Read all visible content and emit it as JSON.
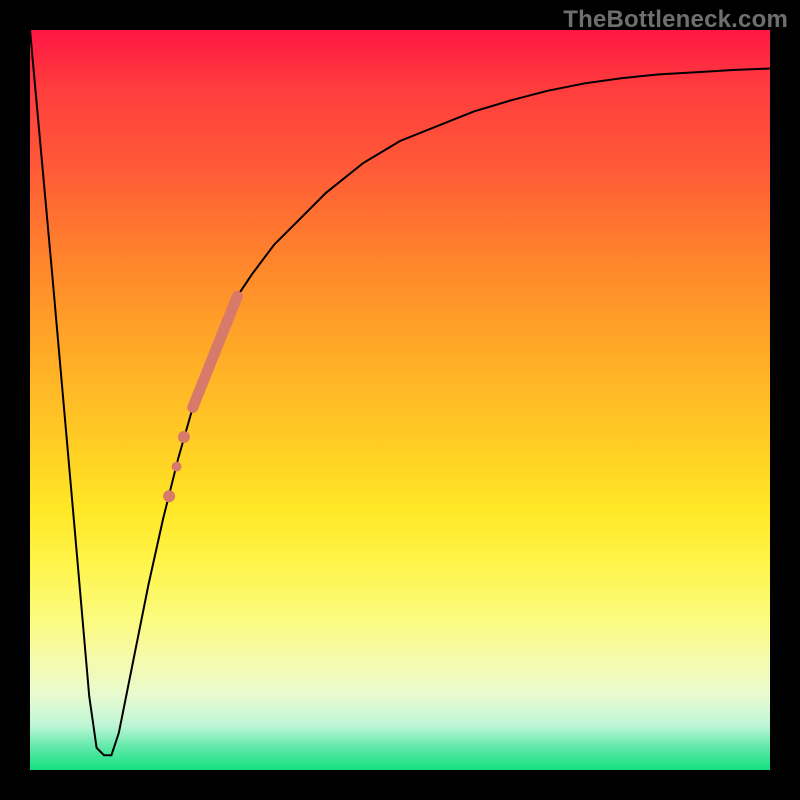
{
  "watermark": "TheBottleneck.com",
  "chart_data": {
    "type": "line",
    "title": "",
    "xlabel": "",
    "ylabel": "",
    "xlim": [
      0,
      100
    ],
    "ylim": [
      0,
      100
    ],
    "grid": false,
    "legend": false,
    "series": [
      {
        "name": "bottleneck-curve",
        "color": "#000000",
        "stroke_width": 2,
        "x": [
          0,
          3,
          6,
          8,
          9,
          10,
          11,
          12,
          14,
          16,
          18,
          20,
          22,
          24,
          26,
          28,
          30,
          33,
          36,
          40,
          45,
          50,
          55,
          60,
          65,
          70,
          75,
          80,
          85,
          90,
          95,
          100
        ],
        "values": [
          100,
          67,
          33,
          10,
          3,
          2,
          2,
          5,
          15,
          25,
          34,
          42,
          49,
          55,
          60,
          64,
          67,
          71,
          74,
          78,
          82,
          85,
          87,
          89,
          90.5,
          91.8,
          92.8,
          93.5,
          94,
          94.3,
          94.6,
          94.8
        ]
      },
      {
        "name": "highlight-segment-upper",
        "type": "line",
        "color": "#d77a6a",
        "stroke_width": 11,
        "linecap": "round",
        "x": [
          22,
          28
        ],
        "values": [
          49,
          64
        ]
      }
    ],
    "points": [
      {
        "name": "dot-1",
        "x": 20.8,
        "y": 45,
        "r": 6,
        "color": "#d77a6a"
      },
      {
        "name": "dot-2",
        "x": 19.8,
        "y": 41,
        "r": 5,
        "color": "#d77a6a"
      },
      {
        "name": "dot-3",
        "x": 18.8,
        "y": 37,
        "r": 6,
        "color": "#d77a6a"
      }
    ]
  }
}
